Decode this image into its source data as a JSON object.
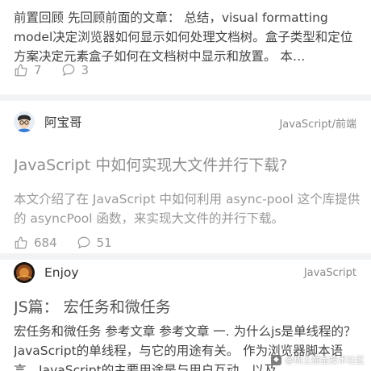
{
  "feed": {
    "items": [
      {
        "excerpt": "前置回顾 先回顾前面的文章： 总结，visual formatting model决定浏览器如何显示如何处理文档树。盒子类型和定位方案决定元素盒子如何在文档树中显示和放置。 本…",
        "likes": "7",
        "comments": "3"
      },
      {
        "author": "阿宝哥",
        "category": "JavaScript/前端",
        "title": "JavaScript 中如何实现大文件并行下载?",
        "excerpt": "本文介绍了在 JavaScript 中如何利用 async-pool 这个库提供的 asyncPool 函数，来实现大文件的并行下载。",
        "likes": "684",
        "comments": "51"
      },
      {
        "author": "Enjoy",
        "category": "JavaScript",
        "title": "JS篇： 宏任务和微任务",
        "excerpt": "宏任务和微任务 参考文章 参考文章 一. 为什么js是单线程的？ JavaScript的单线程，与它的用途有关。 作为浏览器脚本语言，JavaScript的主要用途是与用户互动，以及"
      }
    ]
  },
  "watermark": {
    "text": "@稀土掘金技术社区"
  }
}
